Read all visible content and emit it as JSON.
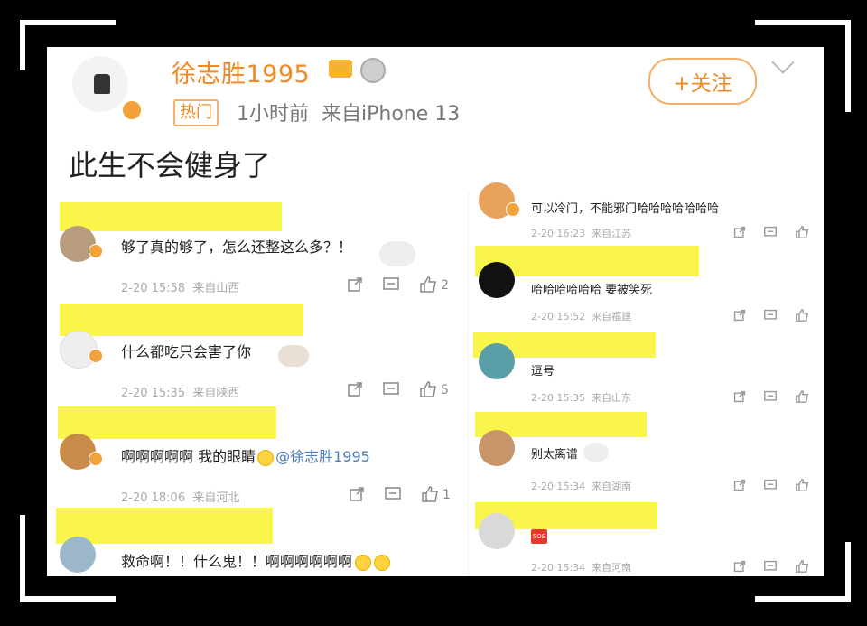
{
  "post": {
    "username": "徐志胜1995",
    "hot_tag": "热门",
    "time": "1小时前",
    "source": "来自iPhone 13",
    "follow_label": "+关注",
    "text": "此生不会健身了"
  },
  "comments_left": [
    {
      "text": "够了真的够了，怎么还整这么多？！",
      "date": "2-20 15:58",
      "location": "来自山西",
      "likes": "2"
    },
    {
      "text": "什么都吃只会害了你",
      "date": "2-20 15:35",
      "location": "来自陕西",
      "likes": "5"
    },
    {
      "text": "啊啊啊啊啊  我的眼睛",
      "mention": "@徐志胜1995",
      "date": "2-20 18:06",
      "location": "来自河北",
      "likes": "1"
    },
    {
      "text": "救命啊！！什么鬼！！啊啊啊啊啊啊"
    }
  ],
  "comments_right": [
    {
      "text": "可以冷门，不能邪门哈哈哈哈哈哈哈",
      "date": "2-20 16:23",
      "location": "来自江苏"
    },
    {
      "text": "哈哈哈哈哈哈 要被笑死",
      "date": "2-20 15:52",
      "location": "来自福建"
    },
    {
      "text": "逗号",
      "date": "2-20 15:35",
      "location": "来自山东"
    },
    {
      "text": "别太离谱",
      "date": "2-20 15:34",
      "location": "来自湖南"
    },
    {
      "text": "",
      "sos_label": "SOS",
      "date": "2-20 15:34",
      "location": "来自河南"
    }
  ],
  "colors": {
    "accent": "#f08a24",
    "redaction": "#f9f54a",
    "mention": "#4d7cb8"
  }
}
